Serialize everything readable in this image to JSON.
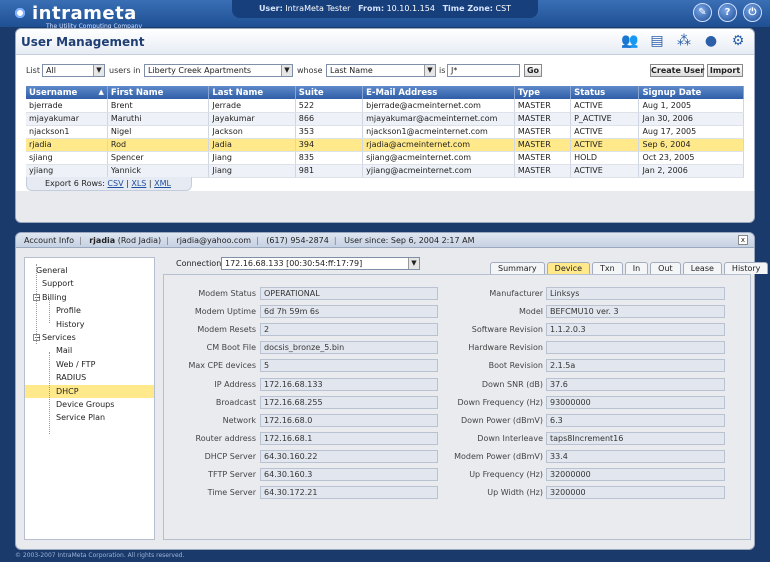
{
  "brand": {
    "name": "intrameta",
    "tagline": "The Utility Computing Company"
  },
  "userbar": {
    "user_label": "User:",
    "user": "IntraMeta Tester",
    "from_label": "From:",
    "from": "10.10.1.154",
    "tz_label": "Time Zone:",
    "tz": "CST"
  },
  "top_icons": [
    "wrench-icon",
    "help-icon",
    "power-icon"
  ],
  "top_icon_glyphs": [
    "✎",
    "?",
    "⏻"
  ],
  "page_title": "User Management",
  "toolbar_icons": [
    "users-icon",
    "ledger-icon",
    "network-icon",
    "globe-icon",
    "gears-icon"
  ],
  "filter": {
    "list_label": "List",
    "list_value": "All",
    "users_in_label": "users in",
    "location": "Liberty Creek Apartments",
    "whose_label": "whose",
    "field": "Last Name",
    "is_label": "is",
    "query": "J*",
    "go": "Go",
    "create_user": "Create User",
    "import": "Import"
  },
  "table": {
    "headers": [
      "Username",
      "First Name",
      "Last Name",
      "Suite",
      "E-Mail Address",
      "Type",
      "Status",
      "Signup Date"
    ],
    "rows": [
      [
        "bjerrade",
        "Brent",
        "Jerrade",
        "522",
        "bjerrade@acmeinternet.com",
        "MASTER",
        "ACTIVE",
        "Aug 1, 2005"
      ],
      [
        "mjayakumar",
        "Maruthi",
        "Jayakumar",
        "866",
        "mjayakumar@acmeinternet.com",
        "MASTER",
        "P_ACTIVE",
        "Jan 30, 2006"
      ],
      [
        "njackson1",
        "Nigel",
        "Jackson",
        "353",
        "njackson1@acmeinternet.com",
        "MASTER",
        "ACTIVE",
        "Aug 17, 2005"
      ],
      [
        "rjadia",
        "Rod",
        "Jadia",
        "394",
        "rjadia@acmeinternet.com",
        "MASTER",
        "ACTIVE",
        "Sep 6, 2004"
      ],
      [
        "sjiang",
        "Spencer",
        "Jiang",
        "835",
        "sjiang@acmeinternet.com",
        "MASTER",
        "HOLD",
        "Oct 23, 2005"
      ],
      [
        "yjiang",
        "Yannick",
        "Jiang",
        "981",
        "yjiang@acmeinternet.com",
        "MASTER",
        "ACTIVE",
        "Jan 2, 2006"
      ]
    ]
  },
  "export": {
    "label": "Export 6 Rows:",
    "csv": "CSV",
    "xls": "XLS",
    "xml": "XML",
    "sep": "|"
  },
  "account": {
    "label": "Account Info",
    "username": "rjadia",
    "fullname": "(Rod Jadia)",
    "email": "rjadia@yahoo.com",
    "phone": "(617) 954-2874",
    "since": "User since: Sep 6, 2004 2:17 AM",
    "close": "x"
  },
  "tree": [
    "General",
    "Support",
    "Billing",
    "Profile",
    "History",
    "Services",
    "Mail",
    "Web / FTP",
    "RADIUS",
    "DHCP",
    "Device Groups",
    "Service Plan"
  ],
  "connection": {
    "label": "Connection",
    "value": "172.16.68.133 [00:30:54:ff:17:79]"
  },
  "tabs": [
    "Summary",
    "Device",
    "Txn",
    "In",
    "Out",
    "Lease",
    "History"
  ],
  "left_fields": [
    [
      "Modem Status",
      "OPERATIONAL"
    ],
    [
      "Modem Uptime",
      "6d 7h 59m 6s"
    ],
    [
      "Modem Resets",
      "2"
    ],
    [
      "CM Boot File",
      "docsis_bronze_5.bin"
    ],
    [
      "Max CPE devices",
      "5"
    ],
    [
      "IP Address",
      "172.16.68.133"
    ],
    [
      "Broadcast",
      "172.16.68.255"
    ],
    [
      "Network",
      "172.16.68.0"
    ],
    [
      "Router address",
      "172.16.68.1"
    ],
    [
      "DHCP Server",
      "64.30.160.22"
    ],
    [
      "TFTP Server",
      "64.30.160.3"
    ],
    [
      "Time Server",
      "64.30.172.21"
    ]
  ],
  "right_fields": [
    [
      "Manufacturer",
      "Linksys"
    ],
    [
      "Model",
      "BEFCMU10 ver. 3"
    ],
    [
      "Software Revision",
      "1.1.2.0.3"
    ],
    [
      "Hardware Revision",
      ""
    ],
    [
      "Boot Revision",
      "2.1.5a"
    ],
    [
      "Down SNR (dB)",
      "37.6"
    ],
    [
      "Down Frequency (Hz)",
      "93000000"
    ],
    [
      "Down Power (dBmV)",
      "6.3"
    ],
    [
      "Down Interleave",
      "taps8Increment16"
    ],
    [
      "Modem Power (dBmV)",
      "33.4"
    ],
    [
      "Up Frequency (Hz)",
      "32000000"
    ],
    [
      "Up Width (Hz)",
      "3200000"
    ]
  ],
  "copyright": "© 2003-2007 IntraMeta Corporation.  All rights reserved."
}
